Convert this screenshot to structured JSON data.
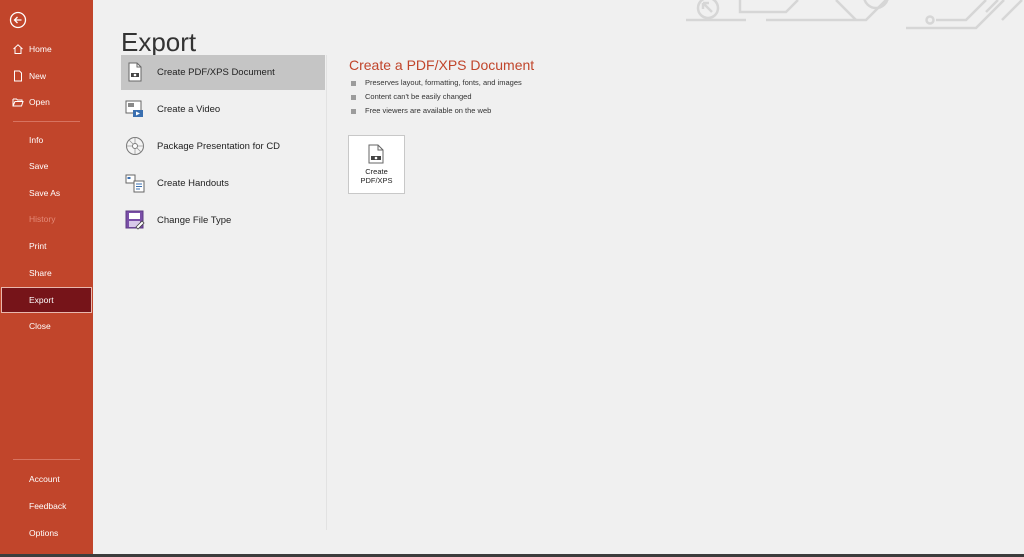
{
  "sidebar": {
    "items": [
      {
        "label": "Home",
        "icon": "home-icon"
      },
      {
        "label": "New",
        "icon": "new-file-icon"
      },
      {
        "label": "Open",
        "icon": "open-folder-icon"
      },
      {
        "label": "Info"
      },
      {
        "label": "Save"
      },
      {
        "label": "Save As"
      },
      {
        "label": "History",
        "state": "disabled"
      },
      {
        "label": "Print"
      },
      {
        "label": "Share"
      },
      {
        "label": "Export",
        "state": "selected"
      },
      {
        "label": "Close"
      },
      {
        "label": "Account"
      },
      {
        "label": "Feedback"
      },
      {
        "label": "Options"
      }
    ]
  },
  "page": {
    "title": "Export"
  },
  "export_options": [
    {
      "label": "Create PDF/XPS Document",
      "icon": "pdf-document-icon",
      "state": "selected"
    },
    {
      "label": "Create a Video",
      "icon": "video-icon"
    },
    {
      "label": "Package Presentation for CD",
      "icon": "cd-icon"
    },
    {
      "label": "Create Handouts",
      "icon": "handouts-icon"
    },
    {
      "label": "Change File Type",
      "icon": "change-file-type-icon"
    }
  ],
  "detail": {
    "title": "Create a PDF/XPS Document",
    "bullets": [
      "Preserves layout, formatting, fonts, and images",
      "Content can't be easily changed",
      "Free viewers are available on the web"
    ],
    "button_line1": "Create",
    "button_line2": "PDF/XPS"
  },
  "colors": {
    "sidebar": "#c1452b",
    "sidebar_selected": "#761419",
    "accent_title": "#c1452b",
    "option_selected": "#c5c5c5",
    "background": "#f0f0f0"
  }
}
